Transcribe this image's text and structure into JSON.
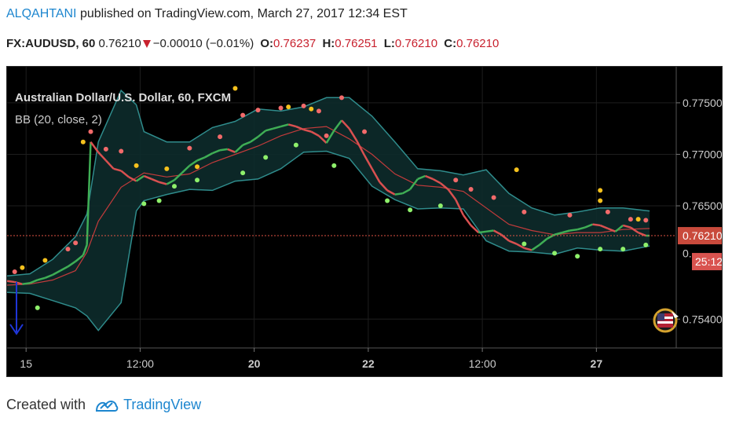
{
  "header": {
    "author": "ALQAHTANI",
    "published_text": " published on TradingView.com, March 27, 2017 12:34 EST",
    "symbol": "FX:AUDUSD, 60",
    "price": "0.76210",
    "change": "−0.00010 (−0.01%)",
    "open_label": "O:",
    "open": "0.76237",
    "high_label": "H:",
    "high": "0.76251",
    "low_label": "L:",
    "low": "0.76210",
    "close_label": "C:",
    "close": "0.76210"
  },
  "chart_data": {
    "type": "line",
    "title": "Australian Dollar/U.S. Dollar, 60, FXCM",
    "indicator_label": "BB (20, close, 2)",
    "y_tick_labels": [
      "0.77500",
      "0.77000",
      "0.76500",
      "0.75400"
    ],
    "y_tick_values": [
      0.775,
      0.77,
      0.765,
      0.754
    ],
    "x_tick_labels": [
      "15",
      "12:00",
      "20",
      "22",
      "12:00",
      "27"
    ],
    "x_tick_positions": [
      0.5,
      3.5,
      6.5,
      9.5,
      12.5,
      15.5
    ],
    "xlim": [
      0,
      17.6
    ],
    "ylim": [
      0.7512,
      0.7785
    ],
    "current_price": 0.7621,
    "current_price_label": "0.76210",
    "countdown_label": "25:12",
    "partial_axis_label": "0.",
    "grid": true,
    "legend": "top-left",
    "colors": {
      "basis": "#c23b3b",
      "bands": "#2f8c8c",
      "fill": "#0d2b2b",
      "up": "#3fae55",
      "down": "#d95050",
      "dot_red": "#f26a6a",
      "dot_green": "#8ef06b",
      "dot_yellow": "#f5c11d",
      "price_line": "#e05545",
      "arrow": "#1f36d8"
    },
    "series": [
      {
        "name": "basis",
        "x": [
          0,
          0.6,
          1.2,
          1.8,
          2.1,
          2.4,
          3,
          3.6,
          4.2,
          4.8,
          5.4,
          6,
          6.6,
          7.2,
          7.8,
          8.4,
          9,
          9.6,
          10.2,
          10.8,
          11.4,
          12,
          12.6,
          13.2,
          13.8,
          14.4,
          15,
          15.6,
          16.2,
          16.9
        ],
        "values": [
          0.7573,
          0.7574,
          0.7578,
          0.7587,
          0.7605,
          0.7635,
          0.7668,
          0.7682,
          0.7678,
          0.7681,
          0.7692,
          0.77,
          0.7708,
          0.7718,
          0.7725,
          0.7727,
          0.7715,
          0.77,
          0.7681,
          0.767,
          0.7668,
          0.7664,
          0.7648,
          0.7632,
          0.7626,
          0.7622,
          0.7624,
          0.7624,
          0.7627,
          0.7628
        ]
      },
      {
        "name": "upper",
        "x": [
          0,
          0.6,
          1.2,
          1.8,
          2.1,
          2.4,
          3,
          3.4,
          3.6,
          4.2,
          4.8,
          5.4,
          6,
          6.6,
          7.2,
          7.8,
          8.4,
          9,
          9.6,
          10.2,
          10.8,
          11.4,
          12,
          12.6,
          13.2,
          13.8,
          14.4,
          15,
          15.6,
          16.2,
          16.9
        ],
        "values": [
          0.7582,
          0.7584,
          0.7598,
          0.762,
          0.7642,
          0.7712,
          0.7762,
          0.7748,
          0.7722,
          0.7712,
          0.7712,
          0.7726,
          0.7732,
          0.7744,
          0.7742,
          0.7746,
          0.7755,
          0.7755,
          0.7737,
          0.7712,
          0.7686,
          0.7684,
          0.768,
          0.7685,
          0.7662,
          0.7648,
          0.7641,
          0.7644,
          0.7648,
          0.7648,
          0.7645
        ]
      },
      {
        "name": "lower",
        "x": [
          0,
          0.6,
          1.2,
          1.8,
          2.1,
          2.4,
          3,
          3.4,
          3.6,
          4.2,
          4.8,
          5.4,
          6,
          6.6,
          7.2,
          7.8,
          8.4,
          9,
          9.6,
          10.2,
          10.8,
          11.4,
          12,
          12.6,
          13.2,
          13.8,
          14.4,
          15,
          15.6,
          16.2,
          16.9
        ],
        "values": [
          0.7566,
          0.7565,
          0.7558,
          0.7551,
          0.7543,
          0.7529,
          0.7556,
          0.7645,
          0.7655,
          0.7661,
          0.7666,
          0.7665,
          0.7674,
          0.7676,
          0.7686,
          0.7702,
          0.7703,
          0.7696,
          0.7669,
          0.7656,
          0.7647,
          0.7648,
          0.7647,
          0.7616,
          0.7606,
          0.7605,
          0.7603,
          0.7609,
          0.7607,
          0.7606,
          0.7611
        ]
      },
      {
        "name": "price",
        "x": [
          0,
          0.2,
          0.4,
          0.6,
          0.8,
          1,
          1.2,
          1.4,
          1.6,
          1.8,
          2,
          2.1,
          2.2,
          2.4,
          2.6,
          2.8,
          3,
          3.2,
          3.4,
          3.6,
          3.8,
          4,
          4.2,
          4.4,
          4.6,
          4.8,
          5,
          5.2,
          5.4,
          5.6,
          5.8,
          6,
          6.2,
          6.4,
          6.6,
          6.8,
          7,
          7.2,
          7.4,
          7.6,
          7.8,
          8,
          8.2,
          8.4,
          8.6,
          8.8,
          9,
          9.2,
          9.4,
          9.6,
          9.8,
          10,
          10.2,
          10.4,
          10.6,
          10.8,
          11,
          11.2,
          11.4,
          11.6,
          11.8,
          12,
          12.2,
          12.4,
          12.6,
          12.8,
          13,
          13.2,
          13.4,
          13.6,
          13.8,
          14,
          14.2,
          14.4,
          14.6,
          14.8,
          15,
          15.2,
          15.4,
          15.6,
          15.8,
          16,
          16.2,
          16.4,
          16.6,
          16.8,
          16.9
        ],
        "values": [
          0.7577,
          0.7576,
          0.7574,
          0.7575,
          0.7578,
          0.758,
          0.7583,
          0.7587,
          0.7591,
          0.7596,
          0.7602,
          0.7612,
          0.7712,
          0.7702,
          0.7694,
          0.7686,
          0.7684,
          0.7678,
          0.7674,
          0.7679,
          0.7676,
          0.7673,
          0.7671,
          0.7675,
          0.7682,
          0.7689,
          0.7694,
          0.7697,
          0.7701,
          0.7704,
          0.7705,
          0.7702,
          0.7709,
          0.7712,
          0.7717,
          0.7723,
          0.7725,
          0.7727,
          0.7729,
          0.7727,
          0.7724,
          0.7722,
          0.7718,
          0.7711,
          0.7723,
          0.7733,
          0.7725,
          0.7713,
          0.7699,
          0.7686,
          0.7673,
          0.7665,
          0.7661,
          0.7662,
          0.7666,
          0.7676,
          0.7679,
          0.7676,
          0.7672,
          0.7666,
          0.7656,
          0.7641,
          0.7631,
          0.7624,
          0.7625,
          0.7626,
          0.7622,
          0.7616,
          0.7613,
          0.7609,
          0.7607,
          0.7612,
          0.7618,
          0.7622,
          0.7624,
          0.7626,
          0.7627,
          0.7629,
          0.7632,
          0.7631,
          0.7628,
          0.7625,
          0.7631,
          0.7629,
          0.7624,
          0.7621,
          0.7621
        ]
      }
    ],
    "dots": {
      "red": [
        [
          0.2,
          0.7586
        ],
        [
          1.6,
          0.7608
        ],
        [
          1.8,
          0.7614
        ],
        [
          2.2,
          0.7722
        ],
        [
          2.6,
          0.7705
        ],
        [
          3,
          0.7703
        ],
        [
          4.8,
          0.7706
        ],
        [
          5.6,
          0.7717
        ],
        [
          6.2,
          0.7738
        ],
        [
          6.6,
          0.7743
        ],
        [
          7.2,
          0.7745
        ],
        [
          7.8,
          0.7747
        ],
        [
          8.2,
          0.7742
        ],
        [
          8.8,
          0.7755
        ],
        [
          9.4,
          0.7722
        ],
        [
          12.8,
          0.7658
        ],
        [
          13.6,
          0.7644
        ],
        [
          14.8,
          0.7641
        ],
        [
          15.8,
          0.7644
        ],
        [
          16.4,
          0.7637
        ],
        [
          16.8,
          0.7636
        ],
        [
          11.8,
          0.7675
        ],
        [
          12.2,
          0.7666
        ],
        [
          8.4,
          0.7718
        ]
      ],
      "green": [
        [
          0.8,
          0.7551
        ],
        [
          3.6,
          0.7652
        ],
        [
          4,
          0.7655
        ],
        [
          4.4,
          0.7669
        ],
        [
          5,
          0.7675
        ],
        [
          6.2,
          0.7682
        ],
        [
          6.8,
          0.7697
        ],
        [
          7.6,
          0.7709
        ],
        [
          8.6,
          0.7689
        ],
        [
          10,
          0.7655
        ],
        [
          10.6,
          0.7646
        ],
        [
          11.4,
          0.765
        ],
        [
          13.6,
          0.7613
        ],
        [
          14.4,
          0.7604
        ],
        [
          15,
          0.7601
        ],
        [
          15.6,
          0.7608
        ],
        [
          16.2,
          0.7608
        ],
        [
          16.8,
          0.7612
        ]
      ],
      "yellow": [
        [
          0.4,
          0.759
        ],
        [
          1,
          0.7597
        ],
        [
          2,
          0.7712
        ],
        [
          3.4,
          0.7689
        ],
        [
          4.2,
          0.7686
        ],
        [
          5,
          0.7688
        ],
        [
          6,
          0.7764
        ],
        [
          7.4,
          0.7746
        ],
        [
          8,
          0.7744
        ],
        [
          13.4,
          0.7685
        ],
        [
          15.6,
          0.7665
        ],
        [
          15.6,
          0.7655
        ],
        [
          16.6,
          0.7637
        ]
      ]
    }
  },
  "footer": {
    "created_with": "Created with",
    "brand": "TradingView"
  }
}
